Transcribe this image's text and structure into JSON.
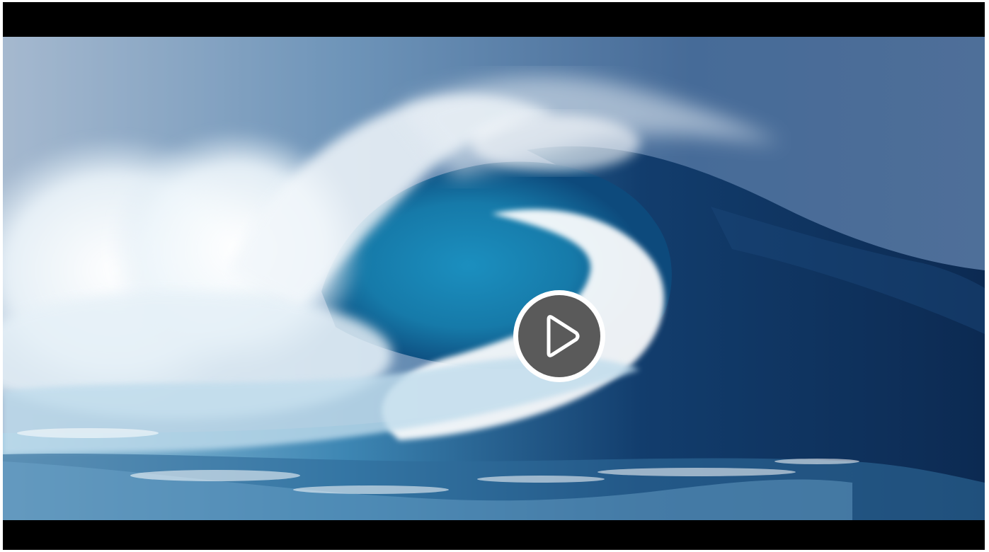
{
  "player": {
    "background_color": "#000000",
    "video": {
      "state": "paused"
    },
    "play_button": {
      "icon": "play-icon",
      "ring_color": "#ffffff",
      "fill_color": "#5a5a5a"
    }
  }
}
